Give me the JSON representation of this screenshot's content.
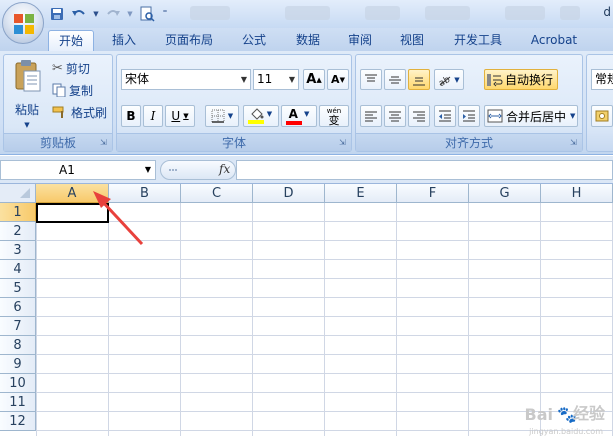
{
  "title_bar": {
    "partial_title": "d"
  },
  "tabs": [
    "开始",
    "插入",
    "页面布局",
    "公式",
    "数据",
    "审阅",
    "视图",
    "开发工具",
    "Acrobat"
  ],
  "active_tab": "开始",
  "clipboard": {
    "paste_label": "粘贴",
    "cut_label": "剪切",
    "copy_label": "复制",
    "format_painter_label": "格式刷",
    "group_label": "剪贴板"
  },
  "font": {
    "font_name": "宋体",
    "font_size": "11",
    "bold": "B",
    "italic": "I",
    "underline": "U",
    "font_color_letter": "A",
    "phonetic_label": "wén",
    "phonetic_char": "变",
    "grow_label": "A",
    "shrink_label": "A",
    "group_label": "字体"
  },
  "alignment": {
    "wrap_text_label": "自动换行",
    "merge_center_label": "合并后居中",
    "group_label": "对齐方式"
  },
  "number": {
    "format_partial": "常规"
  },
  "formula_bar": {
    "name_box": "A1",
    "fx_label": "fx",
    "formula": ""
  },
  "columns": [
    "A",
    "B",
    "C",
    "D",
    "E",
    "F",
    "G",
    "H"
  ],
  "rows": [
    "1",
    "2",
    "3",
    "4",
    "5",
    "6",
    "7",
    "8",
    "9",
    "10",
    "11",
    "12"
  ],
  "selected_cell": "A1",
  "colors": {
    "accent_highlight": "#ffd86e",
    "arrow_annotation": "#e8413c",
    "font_color_bar": "#ff0000",
    "fill_color_bar": "#ffff00"
  },
  "watermark": {
    "text": "Bai",
    "text2": "经验",
    "sub": "jingyan.baidu.com"
  }
}
